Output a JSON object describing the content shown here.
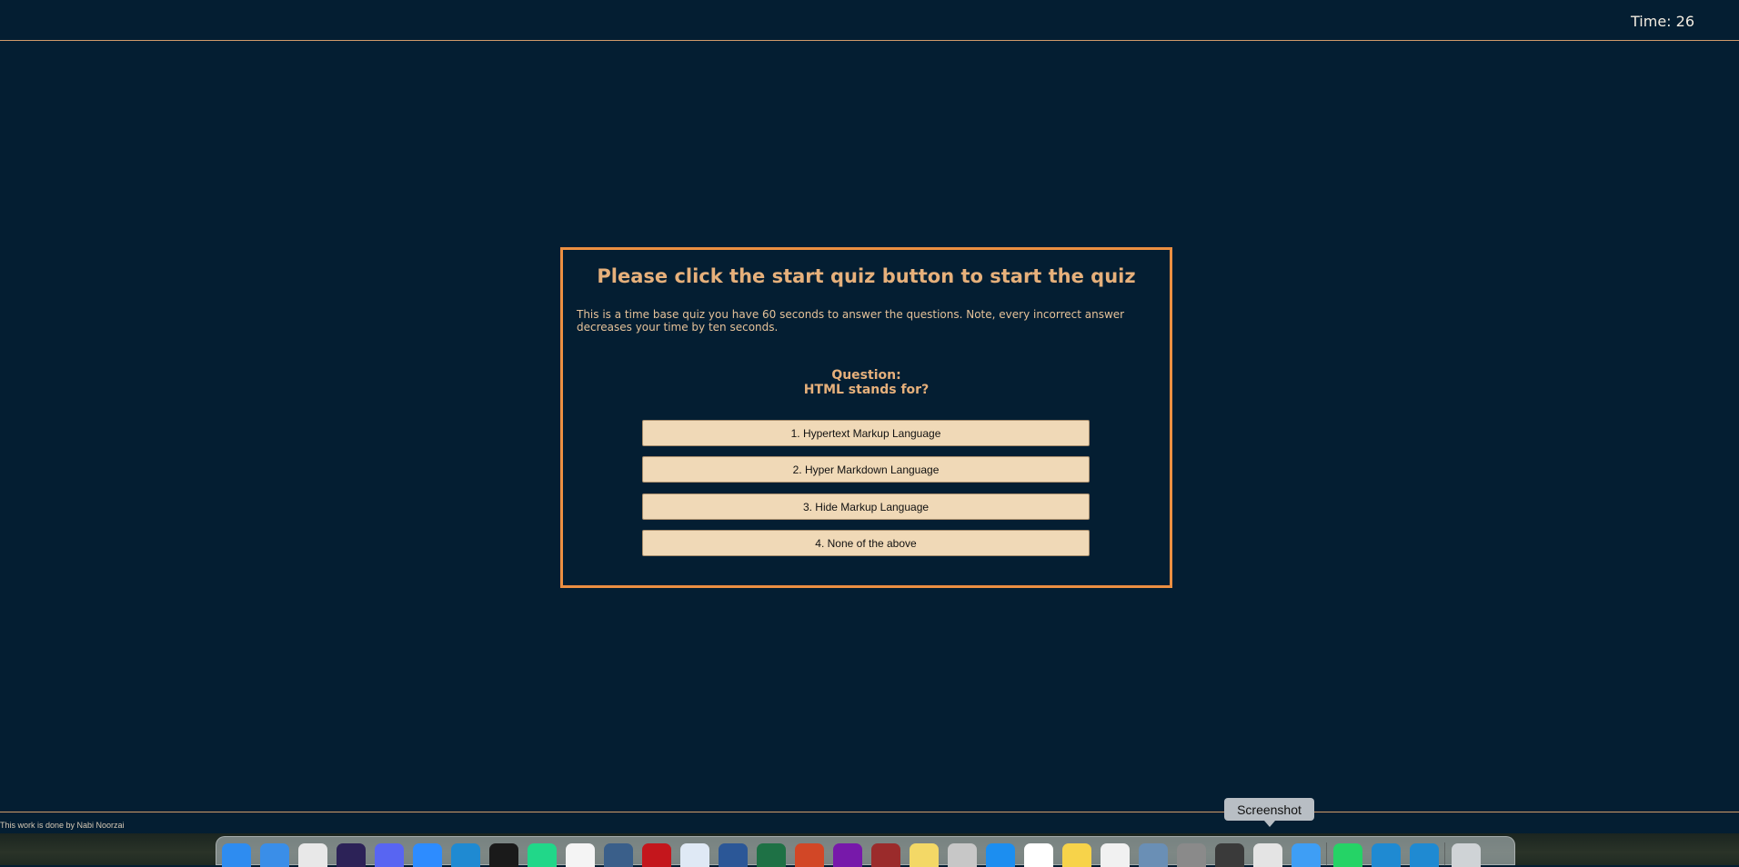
{
  "header": {
    "timer": "Time: 26"
  },
  "quiz": {
    "title": "Please click the start quiz button to start the quiz",
    "description": "This is a time base quiz you have 60 seconds to answer the questions. Note, every incorrect answer decreases your time by ten seconds.",
    "question_label": "Question:",
    "question_text": "HTML stands for?",
    "answers": [
      "1. Hypertext Markup Language",
      "2. Hyper Markdown Language",
      "3. Hide Markup Language",
      "4. None of the above"
    ]
  },
  "footer": {
    "credit": "This work is done by Nabi Noorzai"
  },
  "dock": {
    "tooltip": "Screenshot",
    "apps": [
      {
        "name": "finder-icon",
        "color": "#2e8cf0"
      },
      {
        "name": "safari-icon",
        "color": "#3a8ee8"
      },
      {
        "name": "chrome-icon",
        "color": "#e8e8e8"
      },
      {
        "name": "eclipse-icon",
        "color": "#2c2257"
      },
      {
        "name": "discord-icon",
        "color": "#5865f2"
      },
      {
        "name": "zoom-icon",
        "color": "#2d8cff"
      },
      {
        "name": "vscode-icon",
        "color": "#1f8ad2"
      },
      {
        "name": "terminal-icon",
        "color": "#1a1a1a"
      },
      {
        "name": "pycharm-icon",
        "color": "#21d789"
      },
      {
        "name": "slack-icon",
        "color": "#f4f4f4"
      },
      {
        "name": "mysql-workbench-icon",
        "color": "#3a5f8a"
      },
      {
        "name": "acrobat-icon",
        "color": "#c4161c"
      },
      {
        "name": "sourcetree-icon",
        "color": "#dfe9f5"
      },
      {
        "name": "word-icon",
        "color": "#2b5797"
      },
      {
        "name": "excel-icon",
        "color": "#1e7145"
      },
      {
        "name": "powerpoint-icon",
        "color": "#d24726"
      },
      {
        "name": "onenote-icon",
        "color": "#7719aa"
      },
      {
        "name": "dictionary-icon",
        "color": "#9b2b2b"
      },
      {
        "name": "stickies-icon",
        "color": "#f3d866"
      },
      {
        "name": "launchpad-icon",
        "color": "#c7c7c7"
      },
      {
        "name": "app-store-icon",
        "color": "#1c8ef0"
      },
      {
        "name": "calendar-icon",
        "color": "#ffffff"
      },
      {
        "name": "notes-icon",
        "color": "#f7d34a"
      },
      {
        "name": "reminders-icon",
        "color": "#f1f1f1"
      },
      {
        "name": "preview-icon",
        "color": "#6a8fb5"
      },
      {
        "name": "system-settings-icon",
        "color": "#8a8a8a"
      },
      {
        "name": "proxyman-icon",
        "color": "#3a3a3a"
      },
      {
        "name": "screenshot-icon",
        "color": "#e4e4e4"
      },
      {
        "name": "mail-icon",
        "color": "#3e9ef5"
      },
      {
        "name": "whatsapp-icon",
        "color": "#25d366"
      },
      {
        "name": "vscode-icon",
        "color": "#1f8ad2"
      },
      {
        "name": "vscode-insiders-icon",
        "color": "#1f8ad2"
      },
      {
        "name": "trash-icon",
        "color": "#cfd3d6"
      }
    ]
  }
}
